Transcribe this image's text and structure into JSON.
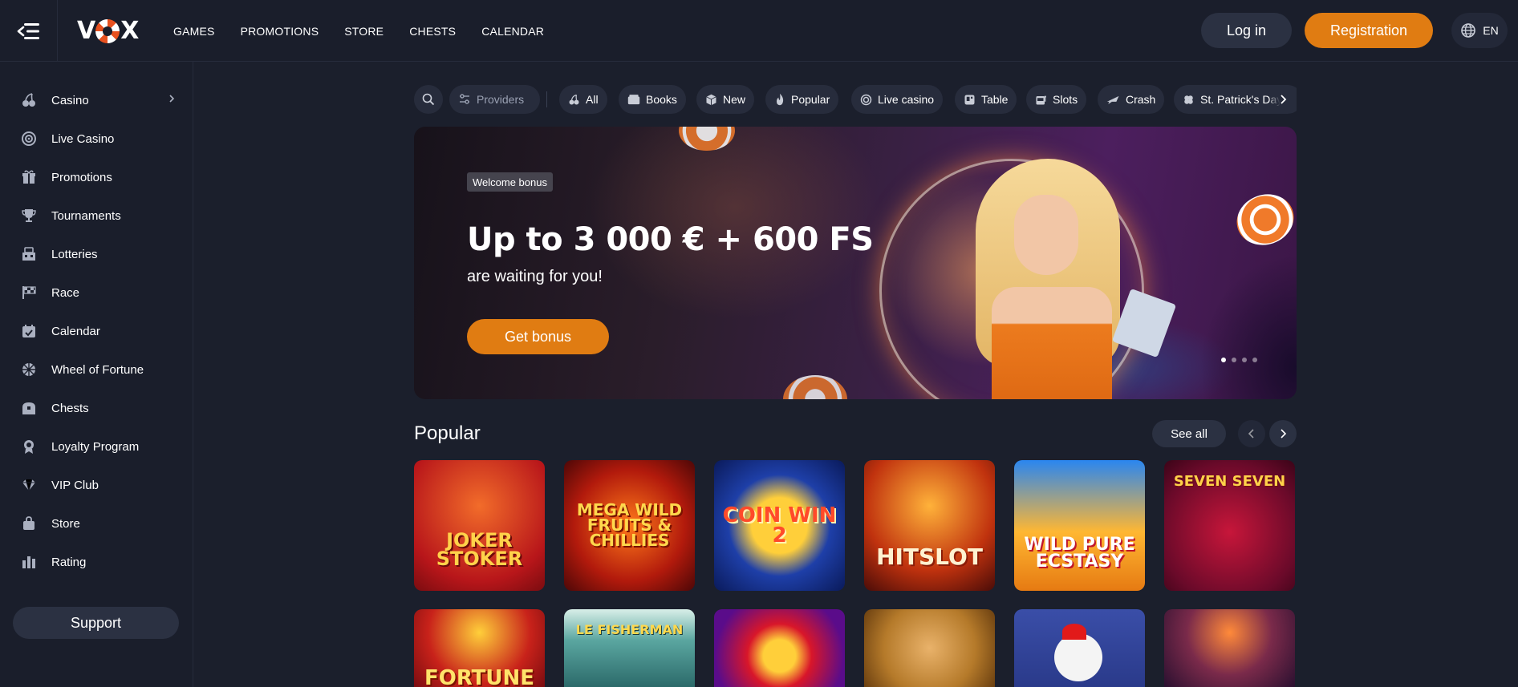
{
  "header": {
    "logo": "VOX",
    "nav": [
      "GAMES",
      "PROMOTIONS",
      "STORE",
      "CHESTS",
      "CALENDAR"
    ],
    "login_label": "Log in",
    "register_label": "Registration",
    "language": "EN"
  },
  "sidebar": {
    "items": [
      {
        "label": "Casino",
        "icon": "cherries-icon"
      },
      {
        "label": "Live Casino",
        "icon": "roulette-icon"
      },
      {
        "label": "Promotions",
        "icon": "gift-icon"
      },
      {
        "label": "Tournaments",
        "icon": "trophy-icon"
      },
      {
        "label": "Lotteries",
        "icon": "lottery-icon"
      },
      {
        "label": "Race",
        "icon": "race-flag-icon"
      },
      {
        "label": "Calendar",
        "icon": "calendar-icon"
      },
      {
        "label": "Wheel of Fortune",
        "icon": "wheel-icon"
      },
      {
        "label": "Chests",
        "icon": "chest-icon"
      },
      {
        "label": "Loyalty Program",
        "icon": "medal-icon"
      },
      {
        "label": "VIP Club",
        "icon": "diamond-icon"
      },
      {
        "label": "Store",
        "icon": "bag-icon"
      },
      {
        "label": "Rating",
        "icon": "rating-icon"
      }
    ],
    "support_label": "Support"
  },
  "filters": {
    "providers_label": "Providers",
    "chips": [
      {
        "label": "All",
        "icon": "cherries-icon"
      },
      {
        "label": "Books",
        "icon": "books-icon"
      },
      {
        "label": "New",
        "icon": "cube-icon"
      },
      {
        "label": "Popular",
        "icon": "flame-icon"
      },
      {
        "label": "Live casino",
        "icon": "roulette-icon"
      },
      {
        "label": "Table",
        "icon": "table-icon"
      },
      {
        "label": "Slots",
        "icon": "slot-machine-icon"
      },
      {
        "label": "Crash",
        "icon": "plane-icon"
      },
      {
        "label": "St. Patrick's Day",
        "icon": "clover-icon"
      }
    ]
  },
  "banner": {
    "badge": "Welcome bonus",
    "title": "Up to 3 000 € + 600 FS",
    "subtitle": "are waiting for you!",
    "cta_label": "Get bonus",
    "slides": 4,
    "active_slide": 1
  },
  "popular": {
    "title": "Popular",
    "see_all_label": "See all",
    "games_row1": [
      {
        "title": "JOKER STOKER"
      },
      {
        "title": "MEGA WILD FRUITS & Chillies"
      },
      {
        "title": "COIN WIN 2"
      },
      {
        "title": "HITSLOT"
      },
      {
        "title": "WILD PURE ECSTASY"
      },
      {
        "title": "SEVEN SEVEN"
      }
    ],
    "games_row2": [
      {
        "title": "FORTUNE"
      },
      {
        "title": "LE FISHERMAN"
      },
      {
        "title": ""
      },
      {
        "title": ""
      },
      {
        "title": ""
      },
      {
        "title": ""
      }
    ]
  },
  "colors": {
    "accent": "#e07c12",
    "background": "#1b1f2c",
    "surface": "#2b3142"
  }
}
